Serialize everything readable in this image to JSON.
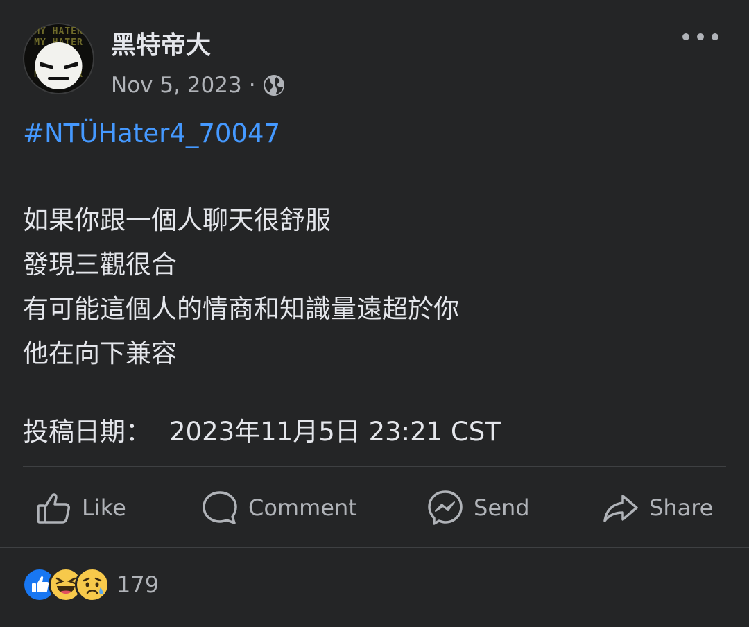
{
  "post": {
    "author": "黑特帝大",
    "avatar_text": [
      "MY HATER",
      "MY HATER",
      "MY HATER"
    ],
    "date": "Nov 5, 2023",
    "separator": "·",
    "privacy_icon": "globe-icon",
    "hashtag": "#NTÜHater4_70047",
    "lines": [
      "如果你跟一個人聊天很舒服",
      "發現三觀很合",
      "有可能這個人的情商和知識量遠超於你",
      "他在向下兼容"
    ],
    "submit_label": "投稿日期：",
    "submit_value": "2023年11月5日 23:21 CST"
  },
  "actions": {
    "like": "Like",
    "comment": "Comment",
    "send": "Send",
    "share": "Share"
  },
  "reactions": {
    "icons": [
      "like-reaction-icon",
      "haha-reaction-icon",
      "sad-reaction-icon"
    ],
    "count": "179"
  },
  "colors": {
    "background": "#242526",
    "text": "#e4e6eb",
    "secondary": "#b0b3b8",
    "hashtag": "#4599ff",
    "like_blue": "#1877f2",
    "emoji_yellow": "#f7c94b"
  }
}
